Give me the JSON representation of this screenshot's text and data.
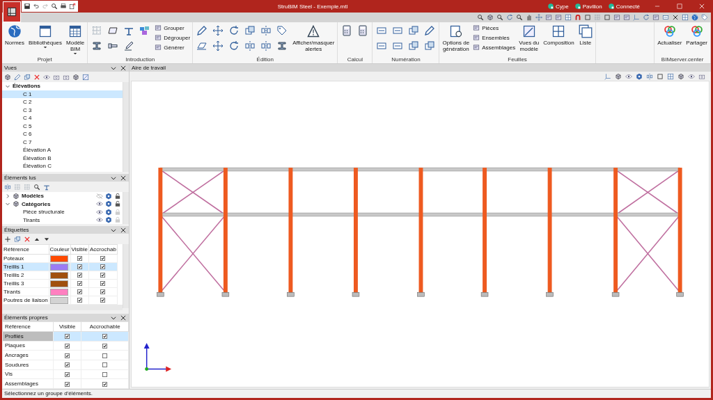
{
  "window": {
    "title": "StruBIM Steel - Exemple.mtl"
  },
  "account": [
    {
      "label": "Cype"
    },
    {
      "label": "Pavilion"
    },
    {
      "label": "Connecté"
    }
  ],
  "ribbon": [
    {
      "label": "Projet",
      "items": [
        {
          "kind": "large",
          "label": "Normes",
          "dropdown": false
        },
        {
          "kind": "large",
          "label": "Bibliothèques",
          "dropdown": true
        },
        {
          "kind": "large",
          "label": "Modèle\nBIM",
          "dropdown": true
        }
      ]
    },
    {
      "label": "Introduction",
      "items": [
        {
          "kind": "tools"
        },
        {
          "kind": "stack",
          "buttons": [
            {
              "label": "Grouper"
            },
            {
              "label": "Dégrouper"
            },
            {
              "label": "Générer"
            }
          ]
        }
      ]
    },
    {
      "label": "Édition",
      "items": [
        {
          "kind": "tools"
        },
        {
          "kind": "large",
          "label": "Afficher/masquer\nalertes",
          "dropdown": false
        }
      ]
    },
    {
      "label": "Calcul",
      "items": [
        {
          "kind": "tools"
        }
      ]
    },
    {
      "label": "Numération",
      "items": [
        {
          "kind": "tools"
        }
      ]
    },
    {
      "label": "Feuilles",
      "items": [
        {
          "kind": "large",
          "label": "Options de\ngénération",
          "dropdown": false
        },
        {
          "kind": "stack",
          "buttons": [
            {
              "label": "Pièces"
            },
            {
              "label": "Ensembles"
            },
            {
              "label": "Assemblages"
            }
          ]
        },
        {
          "kind": "large",
          "label": "Vues du\nmodèle",
          "dropdown": false
        },
        {
          "kind": "large",
          "label": "Composition",
          "dropdown": false
        },
        {
          "kind": "large",
          "label": "Liste",
          "dropdown": false
        }
      ]
    },
    {
      "label": "BIMserver.center",
      "items": [
        {
          "kind": "large",
          "label": "Actualiser",
          "dropdown": false
        },
        {
          "kind": "large",
          "label": "Partager",
          "dropdown": false
        }
      ]
    }
  ],
  "views_panel": {
    "title": "Vues",
    "tree": [
      {
        "label": "Élévations",
        "expanded": true,
        "children": [
          {
            "label": "C 1",
            "selected": true
          },
          {
            "label": "C 2",
            "selected": false
          },
          {
            "label": "C 3",
            "selected": false
          },
          {
            "label": "C 4",
            "selected": false
          },
          {
            "label": "C 5",
            "selected": false
          },
          {
            "label": "C 6",
            "selected": false
          },
          {
            "label": "C 7",
            "selected": false
          },
          {
            "label": "Élévation A",
            "selected": false
          },
          {
            "label": "Élévation B",
            "selected": false
          },
          {
            "label": "Élévation C",
            "selected": false
          }
        ]
      }
    ]
  },
  "read_elements_panel": {
    "title": "Éléments lus",
    "tree": [
      {
        "label": "Modèles",
        "expanded": false,
        "visible": false
      },
      {
        "label": "Catégories",
        "expanded": true,
        "visible": true,
        "children": [
          {
            "label": "Pièce structurale",
            "visible": true
          },
          {
            "label": "Tirants",
            "visible": true
          }
        ]
      }
    ]
  },
  "labels_panel": {
    "title": "Étiquettes",
    "columns": [
      "Référence",
      "Couleur",
      "Visible",
      "Accrochab"
    ],
    "rows": [
      {
        "name": "Poteaux",
        "color": "#ff4a00",
        "visible": true,
        "snappable": true,
        "selected": false
      },
      {
        "name": "Treillis 1",
        "color": "#9b7cf4",
        "visible": true,
        "snappable": true,
        "selected": true
      },
      {
        "name": "Treillis 2",
        "color": "#a0500f",
        "visible": true,
        "snappable": true,
        "selected": false
      },
      {
        "name": "Treillis 3",
        "color": "#a0500e",
        "visible": true,
        "snappable": true,
        "selected": false
      },
      {
        "name": "Tirants",
        "color": "#ff80c0",
        "visible": true,
        "snappable": true,
        "selected": false
      },
      {
        "name": "Poutres de liaison",
        "color": "#d3d3d3",
        "visible": true,
        "snappable": true,
        "selected": false
      }
    ]
  },
  "own_elements_panel": {
    "title": "Éléments propres",
    "columns": [
      "Référence",
      "Visible",
      "Accrochable"
    ],
    "rows": [
      {
        "name": "Profilés",
        "visible": true,
        "snappable": true,
        "selected": true
      },
      {
        "name": "Plaques",
        "visible": true,
        "snappable": true,
        "selected": false
      },
      {
        "name": "Ancrages",
        "visible": true,
        "snappable": false,
        "selected": false
      },
      {
        "name": "Soudures",
        "visible": true,
        "snappable": false,
        "selected": false
      },
      {
        "name": "Vis",
        "visible": true,
        "snappable": false,
        "selected": false
      },
      {
        "name": "Assemblages",
        "visible": true,
        "snappable": true,
        "selected": false
      }
    ]
  },
  "workspace": {
    "title": "Aire de travail"
  },
  "status_bar": "Sélectionnez un groupe d'éléments."
}
